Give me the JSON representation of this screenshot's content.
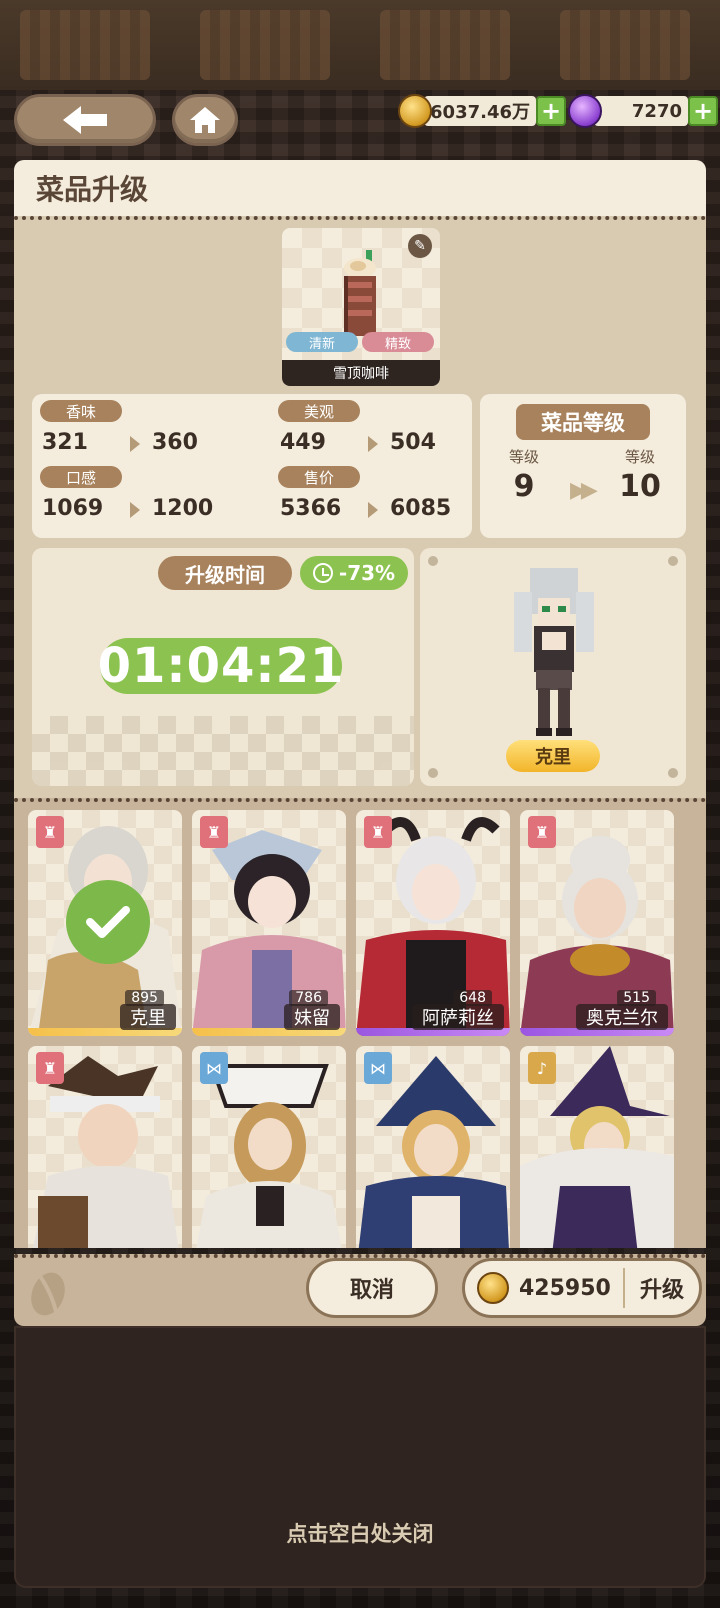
{
  "currency": {
    "gold": "6037.46万",
    "gems": "7270"
  },
  "panel": {
    "title": "菜品升级"
  },
  "dish": {
    "name": "雪顶咖啡",
    "tags": [
      "清新",
      "精致"
    ]
  },
  "stats": [
    {
      "label": "香味",
      "from": "321",
      "to": "360"
    },
    {
      "label": "美观",
      "from": "449",
      "to": "504"
    },
    {
      "label": "口感",
      "from": "1069",
      "to": "1200"
    },
    {
      "label": "售价",
      "from": "5366",
      "to": "6085"
    }
  ],
  "level": {
    "title": "菜品等级",
    "from_label": "等级",
    "from": "9",
    "to_label": "等级",
    "to": "10"
  },
  "timer": {
    "label": "升级时间",
    "discount": "-73%",
    "value": "01:04:21"
  },
  "assigned_chef": {
    "name": "克里"
  },
  "chefs": [
    {
      "name": "克里",
      "power": "895",
      "role": "chef",
      "selected": true
    },
    {
      "name": "妹留",
      "power": "786",
      "role": "chef",
      "selected": false
    },
    {
      "name": "阿萨莉丝",
      "power": "648",
      "role": "chef",
      "selected": false
    },
    {
      "name": "奥克兰尔",
      "power": "515",
      "role": "chef",
      "selected": false
    },
    {
      "name": "",
      "power": "",
      "role": "chef",
      "selected": false
    },
    {
      "name": "",
      "power": "",
      "role": "server",
      "selected": false
    },
    {
      "name": "",
      "power": "",
      "role": "server",
      "selected": false
    },
    {
      "name": "",
      "power": "",
      "role": "singer",
      "selected": false
    }
  ],
  "actions": {
    "cancel": "取消",
    "cost": "425950",
    "upgrade": "升级"
  },
  "hint": "点击空白处关闭"
}
